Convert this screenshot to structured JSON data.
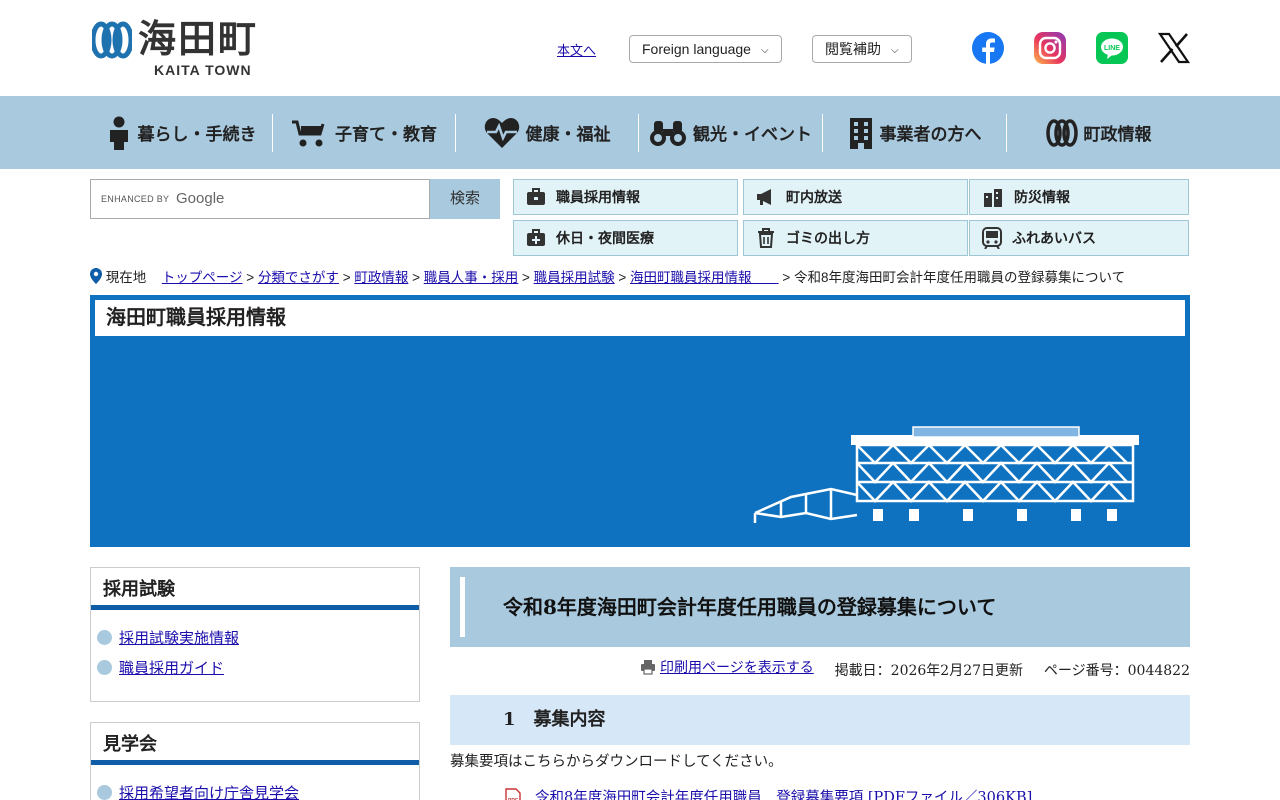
{
  "header": {
    "logo_text": "海田町",
    "logo_sub": "KAITA TOWN",
    "skip_link": "本文へ",
    "lang_dropdown": "Foreign language",
    "access_dropdown": "閲覧補助"
  },
  "colors": {
    "nav_bg": "#a9c9de",
    "banner_bg": "#0f72c1",
    "accent_dark": "#0f5ca8",
    "quicklink_bg": "#e2f3f8"
  },
  "gnav": [
    {
      "label": "暮らし・手続き",
      "icon": "person-icon"
    },
    {
      "label": "子育て・教育",
      "icon": "stroller-icon"
    },
    {
      "label": "健康・福祉",
      "icon": "heartbeat-icon"
    },
    {
      "label": "観光・イベント",
      "icon": "binoculars-icon"
    },
    {
      "label": "事業者の方へ",
      "icon": "building-icon"
    },
    {
      "label": "町政情報",
      "icon": "town-logo-icon"
    }
  ],
  "search": {
    "enhanced_by": "ENHANCED BY",
    "google": "Google",
    "button": "検索"
  },
  "quicklinks": [
    {
      "label": "職員採用情報",
      "icon": "briefcase-icon"
    },
    {
      "label": "町内放送",
      "icon": "megaphone-icon"
    },
    {
      "label": "防災情報",
      "icon": "disaster-icon"
    },
    {
      "label": "休日・夜間医療",
      "icon": "medical-bag-icon"
    },
    {
      "label": "ゴミの出し方",
      "icon": "trash-icon"
    },
    {
      "label": "ふれあいバス",
      "icon": "bus-icon"
    }
  ],
  "breadcrumb": {
    "here": "現在地",
    "items": [
      "トップページ",
      "分類でさがす",
      "町政情報",
      "職員人事・採用",
      "職員採用試験",
      "海田町職員採用情報　　"
    ],
    "current": "令和8年度海田町会計年度任用職員の登録募集について"
  },
  "banner": {
    "title": "海田町職員採用情報"
  },
  "side_boxes": [
    {
      "title": "採用試験",
      "items": [
        "採用試験実施情報",
        "職員採用ガイド"
      ]
    },
    {
      "title": "見学会",
      "items": [
        "採用希望者向け庁舎見学会"
      ]
    }
  ],
  "main": {
    "title": "令和8年度海田町会計年度任用職員の登録募集について",
    "print_link": "印刷用ページを表示する",
    "published": "掲載日：2026年2月27日更新",
    "page_number": "ページ番号：0044822",
    "section_heading": "1　募集内容",
    "body_text": "募集要項はこちらからダウンロードしてください。",
    "pdf_link": "令和8年度海田町会計年度任用職員　登録募集要項 [PDFファイル／306KB]"
  }
}
